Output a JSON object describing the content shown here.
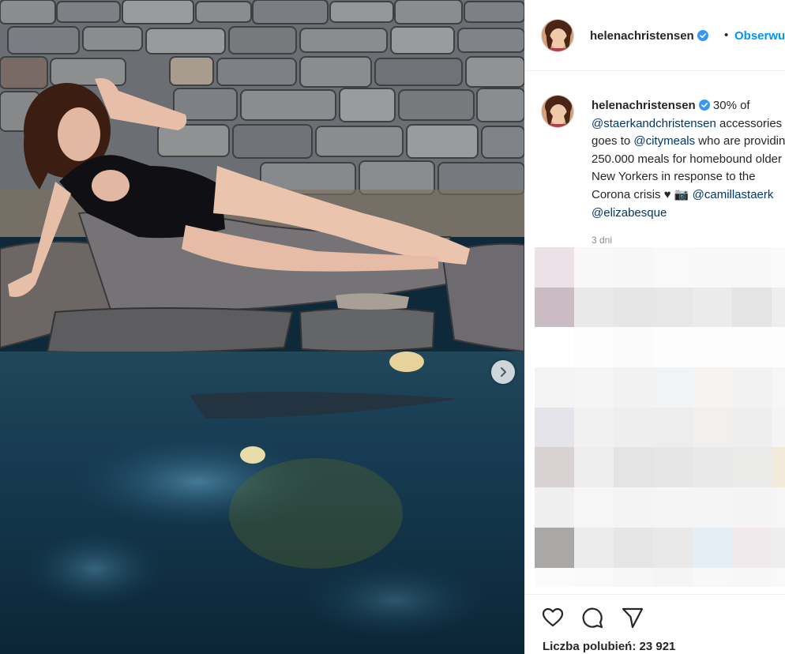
{
  "photo": {
    "alt_icon": "carousel-next-icon"
  },
  "header": {
    "username": "helenachristensen",
    "separator": "•",
    "follow_label": "Obserwuj"
  },
  "caption": {
    "username": "helenachristensen",
    "lines": [
      {
        "pre": "30% of",
        "tag": "",
        "post": ""
      },
      {
        "pre": "",
        "tag": "@staerkandchristensen",
        "post": " accessories"
      },
      {
        "pre": "goes to ",
        "tag": "@citymeals",
        "post": " who are providing"
      },
      {
        "pre": "250.000 meals for homebound older",
        "tag": "",
        "post": ""
      },
      {
        "pre": "New Yorkers in response to the",
        "tag": "",
        "post": ""
      },
      {
        "pre": "Corona crisis ♥ 📷 ",
        "tag": "@camillastaerk",
        "post": ""
      },
      {
        "pre": "",
        "tag": "@elizabesque",
        "post": ""
      }
    ],
    "timestamp": "3 dni"
  },
  "actions": {
    "like_icon": "heart-icon",
    "comment_icon": "comment-icon",
    "share_icon": "share-icon",
    "likes_text": "Liczba polubień: 23 921"
  },
  "colors": {
    "link_blue": "#0095f6",
    "tag_blue": "#00376b",
    "text": "#262626",
    "muted": "#8e8e8e",
    "verified": "#3897f0"
  },
  "blur_cells": [
    "#ece1e6",
    "#f8f8f8",
    "#f7f7f7",
    "#f9f9f9",
    "#f8f8f8",
    "#f8f8f8",
    "#fafafa",
    "#cbbcc4",
    "#e9e9e9",
    "#e6e6e6",
    "#e7e7e7",
    "#ebebeb",
    "#e4e4e4",
    "#eeeeee",
    "#ffffff",
    "#fcfcfc",
    "#fbfbfb",
    "#fdfdfd",
    "#fcfcfc",
    "#fcfcfc",
    "#fdfdfd",
    "#f3f3f3",
    "#f5f5f5",
    "#f2f2f2",
    "#f0f4f7",
    "#f7f3f3",
    "#f2f2f2",
    "#f6f6f6",
    "#e4e4ea",
    "#f1f1f1",
    "#eeeeee",
    "#ededee",
    "#f2efee",
    "#eeeeee",
    "#f4f4f4",
    "#d9d2d2",
    "#eeeeee",
    "#e4e4e4",
    "#e6e6e6",
    "#e9e9e9",
    "#ebece9",
    "#f1ead8",
    "#efefef",
    "#f6f6f6",
    "#f4f4f4",
    "#f5f5f5",
    "#f5f5f5",
    "#f4f4f4",
    "#f6f6f6",
    "#a9a8a6",
    "#ececec",
    "#e6e6e6",
    "#e9e9e9",
    "#e4eef4",
    "#f1e9ec",
    "#eeeeee",
    "#fbfbfb",
    "#f9f9f9",
    "#f7f7f7",
    "#f5f5f5",
    "#f8f8f8",
    "#f7f7f7",
    "#f9f9f9"
  ]
}
